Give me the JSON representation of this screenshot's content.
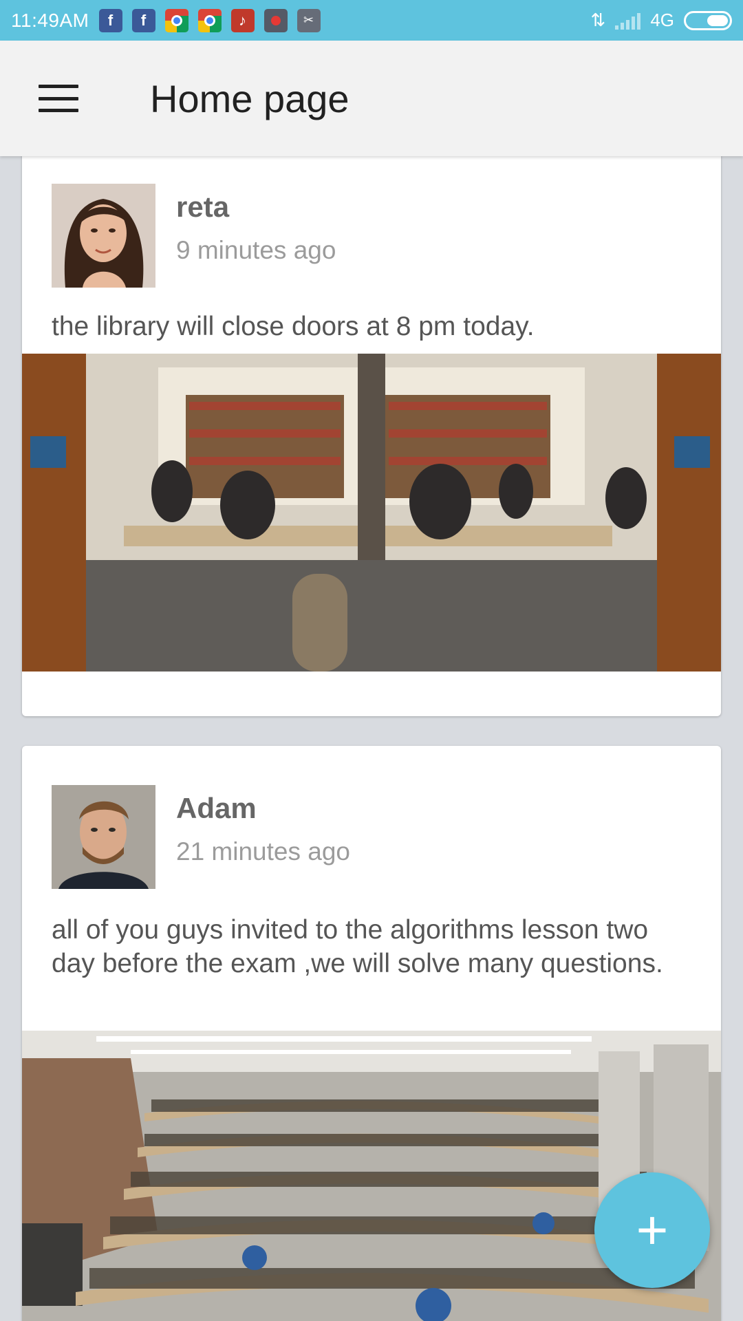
{
  "status_bar": {
    "time": "11:49AM",
    "network": "4G",
    "notification_icons": [
      "facebook-icon",
      "facebook-icon",
      "chrome-icon",
      "chrome-icon",
      "tiktok-icon",
      "screen-record-icon",
      "screenshot-icon"
    ]
  },
  "app_bar": {
    "title": "Home page"
  },
  "posts": [
    {
      "author": "reta",
      "time": "9 minutes ago",
      "text": "the library will close doors at 8 pm today.",
      "image": "library study room with students at tables"
    },
    {
      "author": "Adam",
      "time": "21 minutes ago",
      "text": "all of you guys invited to the algorithms lesson two day before the exam ,we will solve many questions.",
      "image": "large lecture hall full of students"
    }
  ],
  "fab": {
    "label": "+"
  },
  "colors": {
    "accent": "#5ec3de",
    "app_bar_bg": "#f2f2f2",
    "feed_bg": "#d8dbe0"
  }
}
